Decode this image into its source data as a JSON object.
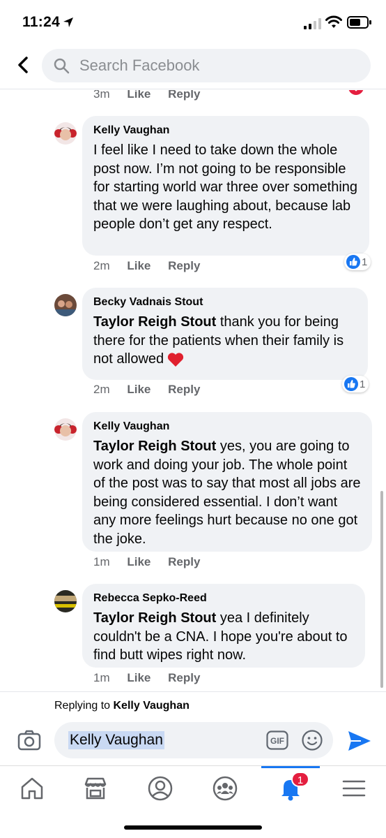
{
  "status": {
    "time": "11:24"
  },
  "search": {
    "placeholder": "Search Facebook"
  },
  "comments": [
    {
      "meta": {
        "time": "3m",
        "like": "Like",
        "reply": "Reply"
      }
    },
    {
      "author": "Kelly Vaughan",
      "text": "I feel like I need to take down the whole post now. I’m not going to be responsible for starting world war three over something that we were laughing about, because lab people don’t get any respect.",
      "meta": {
        "time": "2m",
        "like": "Like",
        "reply": "Reply"
      },
      "reactions": "1"
    },
    {
      "author": "Becky Vadnais Stout",
      "mention": "Taylor Reigh Stout",
      "text": " thank you for being there for the patients when their family is not allowed",
      "meta": {
        "time": "2m",
        "like": "Like",
        "reply": "Reply"
      },
      "reactions": "1"
    },
    {
      "author": "Kelly Vaughan",
      "mention": "Taylor Reigh Stout",
      "text": " yes, you are going to work and doing your job. The whole point of the post was to say that most all jobs are being considered essential. I don’t want any more feelings hurt because no one got the joke.",
      "meta": {
        "time": "1m",
        "like": "Like",
        "reply": "Reply"
      }
    },
    {
      "author": "Rebecca Sepko-Reed",
      "mention": "Taylor Reigh Stout",
      "text": " yea I definitely couldn't be a CNA. I hope you're about to find butt wipes right now.",
      "meta": {
        "time": "1m",
        "like": "Like",
        "reply": "Reply"
      }
    }
  ],
  "composer": {
    "replying_prefix": "Replying to ",
    "replying_to": "Kelly Vaughan",
    "input_value": "Kelly Vaughan",
    "gif_label": "GIF"
  },
  "tabbar": {
    "notification_badge": "1",
    "tabs": [
      "home-icon",
      "marketplace-icon",
      "profile-icon",
      "groups-icon",
      "notifications-icon",
      "menu-icon"
    ]
  },
  "colors": {
    "accent": "#1877f2",
    "bubble": "#f0f2f5",
    "badge": "#e41e3f",
    "meta": "#65676b"
  }
}
